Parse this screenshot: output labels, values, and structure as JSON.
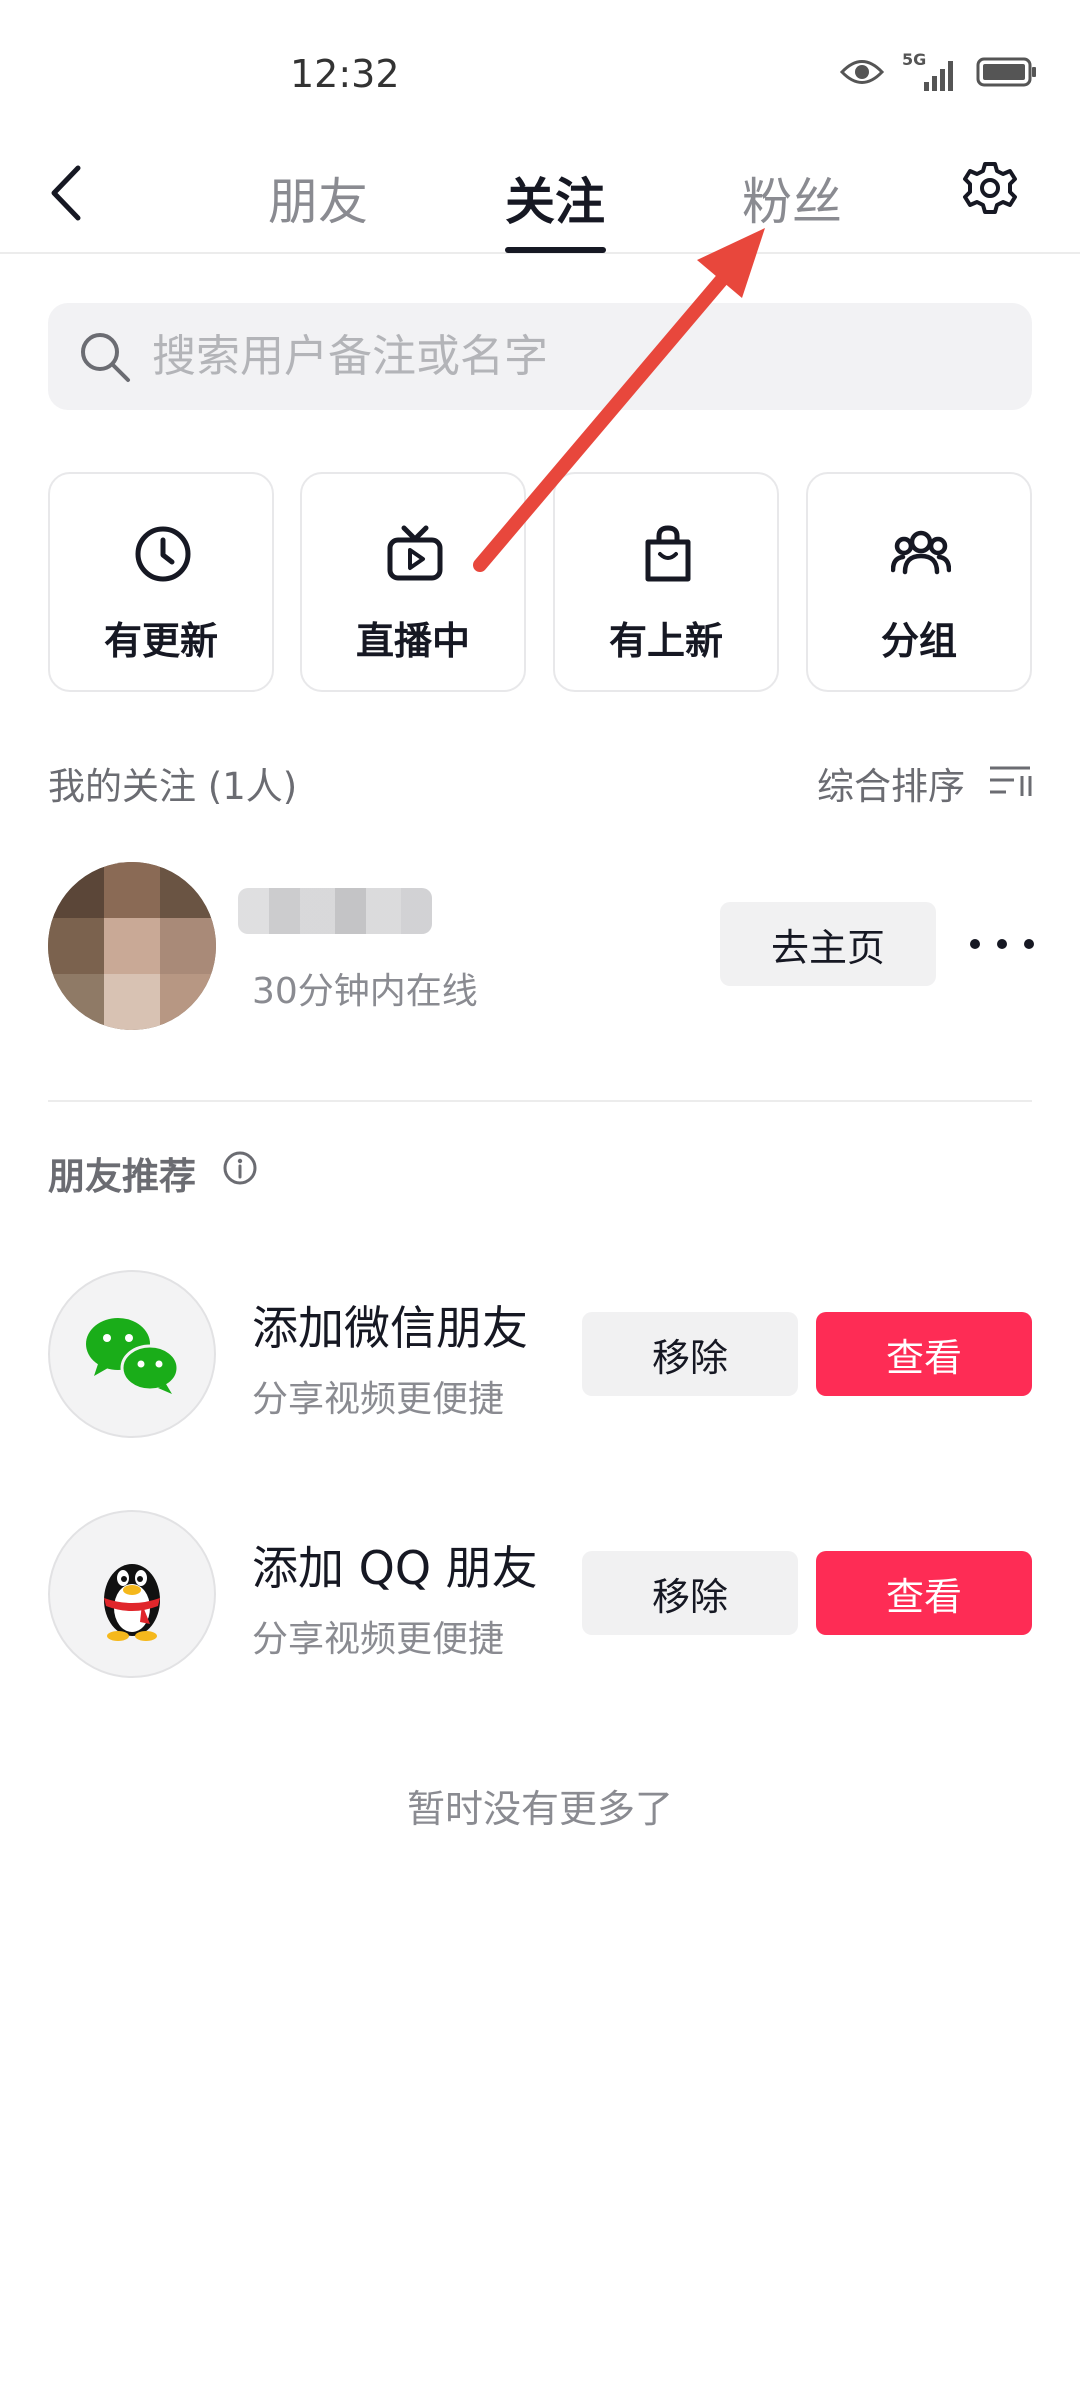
{
  "status_bar": {
    "time": "12:32",
    "network_label": "5G"
  },
  "nav": {
    "tabs": [
      {
        "label": "朋友",
        "active": false
      },
      {
        "label": "关注",
        "active": true
      },
      {
        "label": "粉丝",
        "active": false
      }
    ]
  },
  "search": {
    "placeholder": "搜索用户备注或名字",
    "value": ""
  },
  "quick_filters": [
    {
      "label": "有更新",
      "icon": "clock-icon"
    },
    {
      "label": "直播中",
      "icon": "live-tv-icon"
    },
    {
      "label": "有上新",
      "icon": "shopping-bag-icon"
    },
    {
      "label": "分组",
      "icon": "group-icon"
    }
  ],
  "following": {
    "header": "我的关注 (1人)",
    "sort_label": "综合排序",
    "users": [
      {
        "status": "30分钟内在线",
        "action": "去主页"
      }
    ]
  },
  "recommendations": {
    "title": "朋友推荐",
    "items": [
      {
        "title": "添加微信朋友",
        "subtitle": "分享视频更便捷",
        "remove": "移除",
        "view": "查看",
        "icon": "wechat-icon"
      },
      {
        "title": "添加 QQ 朋友",
        "subtitle": "分享视频更便捷",
        "remove": "移除",
        "view": "查看",
        "icon": "qq-penguin-icon"
      }
    ]
  },
  "end_message": "暂时没有更多了",
  "colors": {
    "accent": "#fe2c55",
    "annotation_arrow": "#e8473c",
    "text": "#161823",
    "muted": "#8a8b91"
  }
}
